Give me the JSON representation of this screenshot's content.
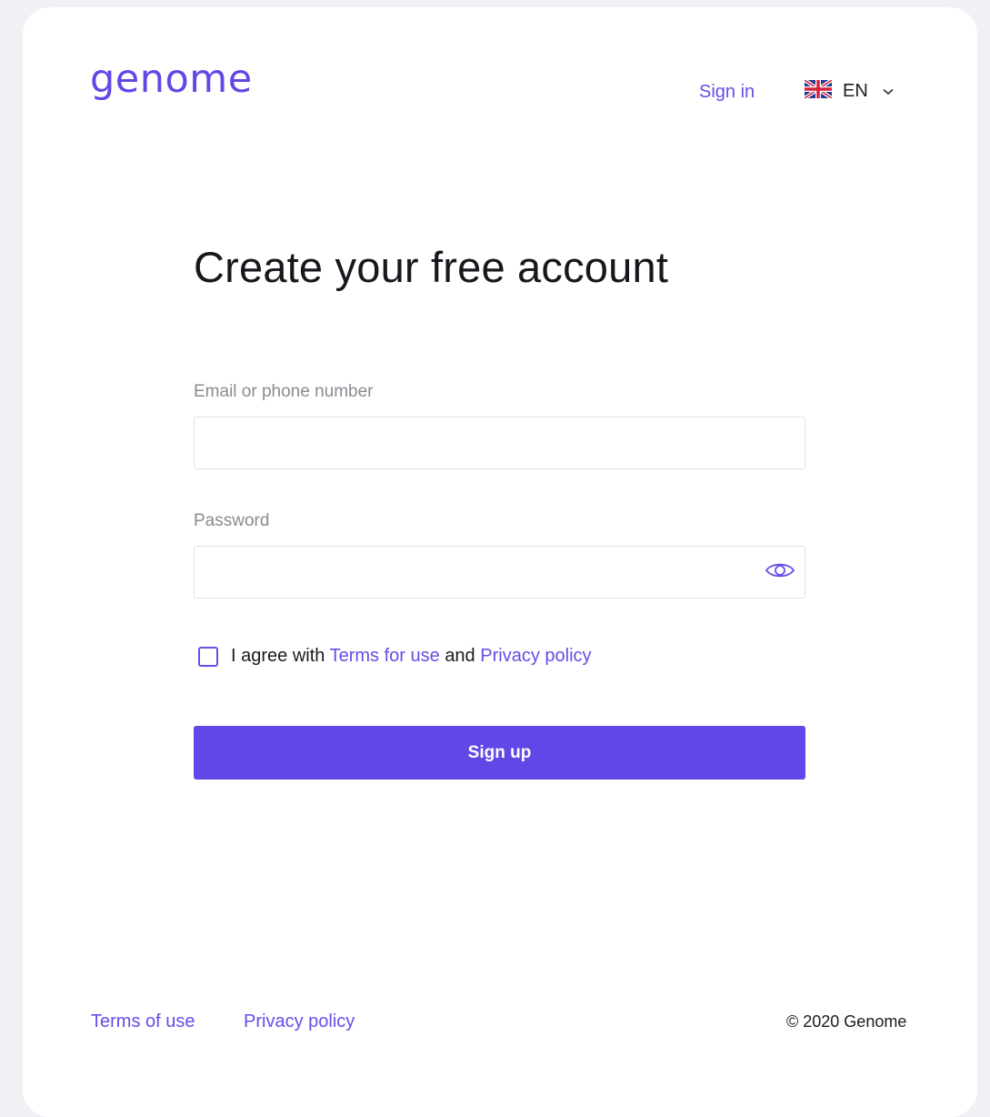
{
  "brand": {
    "logo_text": "genome"
  },
  "header": {
    "sign_in": "Sign in",
    "language": {
      "code": "EN",
      "flag_icon": "uk-flag-icon",
      "chevron_icon": "chevron-down-icon"
    }
  },
  "form": {
    "title": "Create your free account",
    "email": {
      "label": "Email or phone number",
      "value": "",
      "placeholder": ""
    },
    "password": {
      "label": "Password",
      "value": "",
      "placeholder": "",
      "toggle_icon": "eye-icon"
    },
    "agree": {
      "checked": false,
      "prefix": "I agree with",
      "terms_link": "Terms for use",
      "conjunction": "and",
      "privacy_link": "Privacy policy"
    },
    "submit_label": "Sign up"
  },
  "footer": {
    "terms": "Terms of use",
    "privacy": "Privacy policy",
    "copyright": "© 2020 Genome"
  },
  "colors": {
    "accent": "#6148e6",
    "link": "#6a4be8",
    "page_background": "#f0f1f5",
    "card_background": "#ffffff",
    "text": "#17171d",
    "label": "#8a8a92"
  }
}
